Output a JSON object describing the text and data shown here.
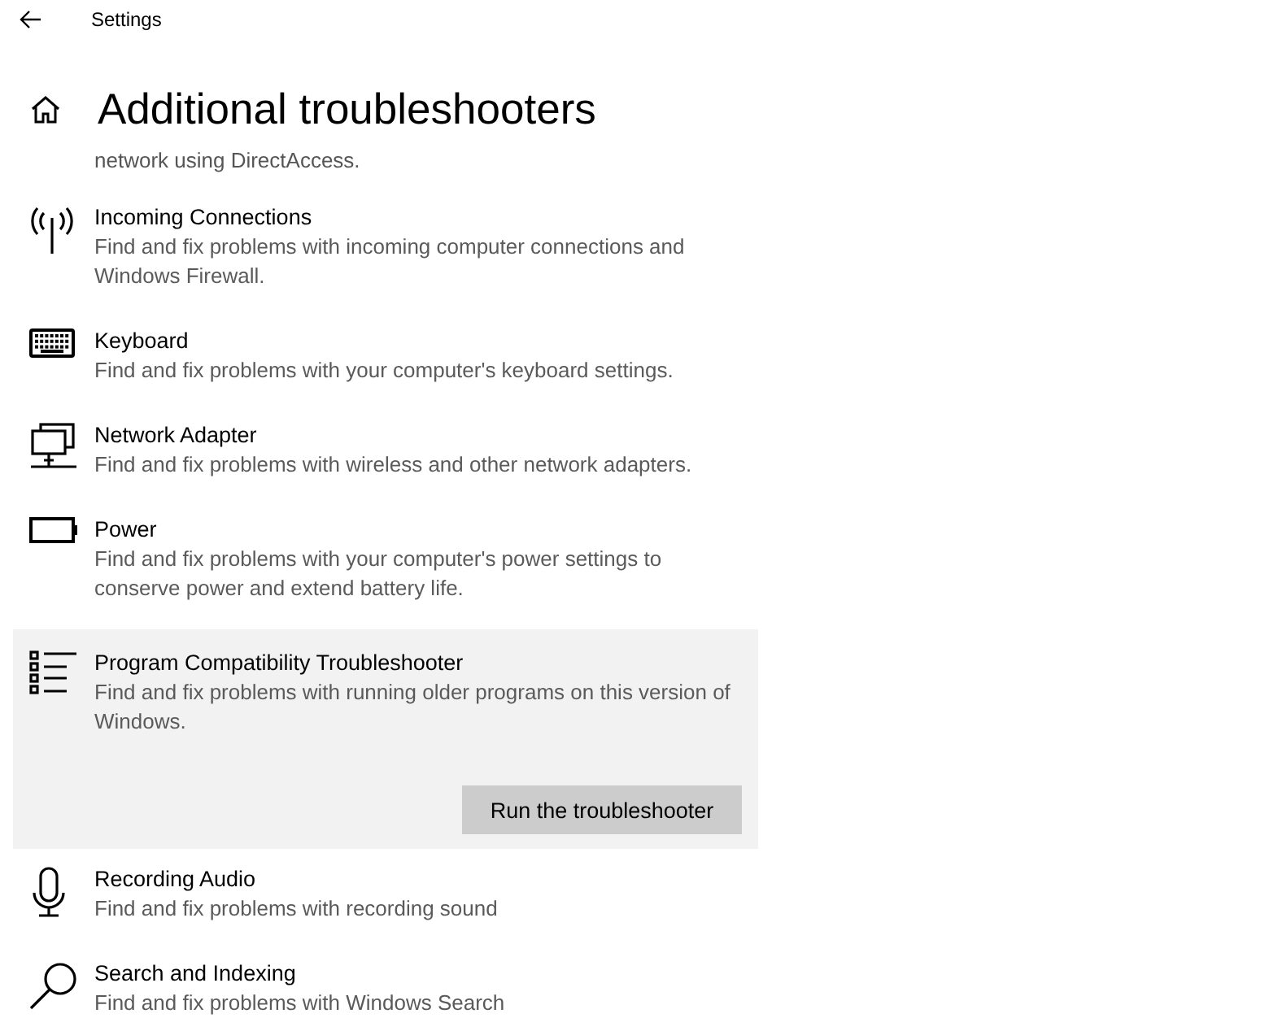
{
  "window": {
    "title": "Settings"
  },
  "page_title": "Additional troubleshooters",
  "cut_description": "network using DirectAccess.",
  "items": [
    {
      "kind": "antenna",
      "title": "Incoming Connections",
      "description": "Find and fix problems with incoming computer connections and Windows Firewall.",
      "selected": false
    },
    {
      "kind": "keyboard",
      "title": "Keyboard",
      "description": "Find and fix problems with your computer's keyboard settings.",
      "selected": false
    },
    {
      "kind": "network",
      "title": "Network Adapter",
      "description": "Find and fix problems with wireless and other network adapters.",
      "selected": false
    },
    {
      "kind": "battery",
      "title": "Power",
      "description": "Find and fix problems with your computer's power settings to conserve power and extend battery life.",
      "selected": false
    },
    {
      "kind": "list",
      "title": "Program Compatibility Troubleshooter",
      "description": "Find and fix problems with running older programs on this version of Windows.",
      "selected": true,
      "button": "Run the troubleshooter"
    },
    {
      "kind": "microphone",
      "title": "Recording Audio",
      "description": "Find and fix problems with recording sound",
      "selected": false
    },
    {
      "kind": "search",
      "title": "Search and Indexing",
      "description": "Find and fix problems with Windows Search",
      "selected": false
    }
  ]
}
